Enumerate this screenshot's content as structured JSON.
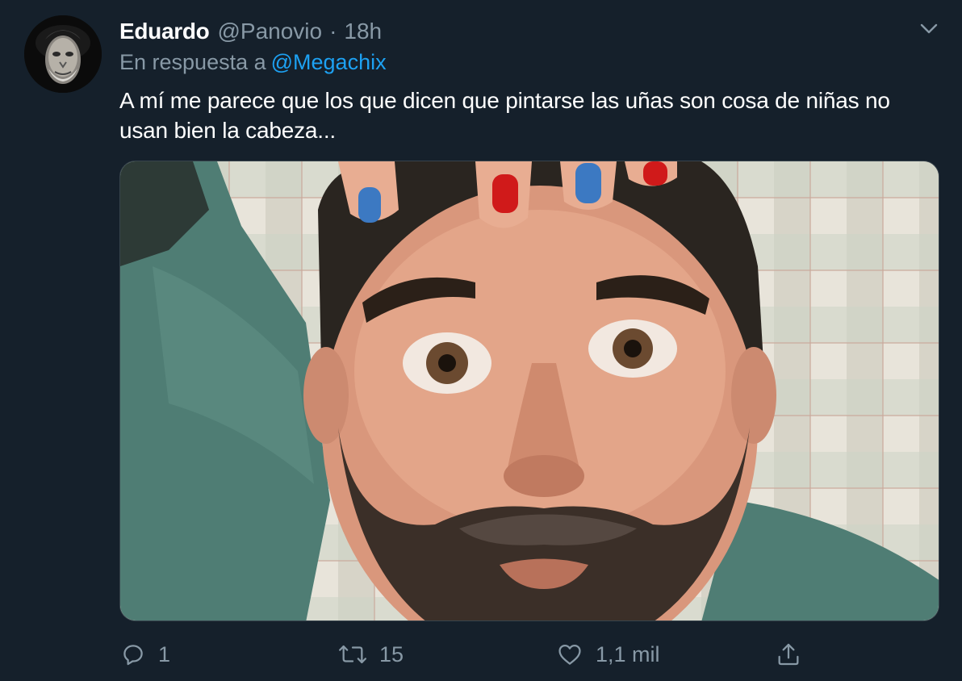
{
  "tweet": {
    "author_name": "Eduardo",
    "author_handle": "@Panovio",
    "separator": "·",
    "time": "18h",
    "reply_prefix": "En respuesta a",
    "reply_mention": "@Megachix",
    "text": "A mí me parece que los que dicen que pintarse las uñas son cosa de niñas no usan bien la cabeza...",
    "media_alt": "Hombre con uñas pintadas de rojo y azul apoyadas sobre la cabeza"
  },
  "actions": {
    "reply_count": "1",
    "retweet_count": "15",
    "like_count": "1,1 mil"
  },
  "icons": {
    "menu": "chevron-down-icon",
    "reply": "reply-icon",
    "retweet": "retweet-icon",
    "like": "heart-icon",
    "share": "share-icon"
  },
  "colors": {
    "background": "#15202b",
    "secondary_text": "#8899a6",
    "link": "#1da1f2",
    "border": "#38444d",
    "nail_red": "#d01a1a",
    "nail_blue": "#3c79c2"
  }
}
